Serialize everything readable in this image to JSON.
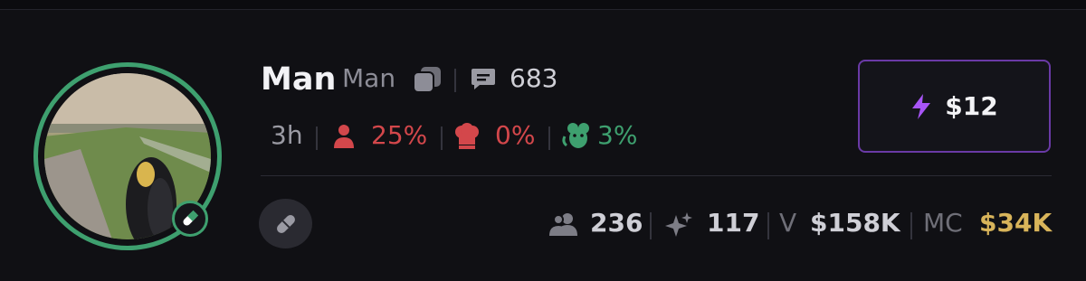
{
  "token": {
    "name": "Man",
    "ticker": "Man",
    "comments": "683",
    "age": "3h",
    "holder_pct": "25%",
    "chef_pct": "0%",
    "rat_pct": "3%"
  },
  "buy": {
    "label": "$12"
  },
  "stats": {
    "holders": "236",
    "boosts": "117",
    "volume_label": "V",
    "volume": "$158K",
    "mc_label": "MC",
    "mc": "$34K"
  },
  "colors": {
    "ring": "#3ea06f",
    "danger": "#d3474b",
    "accent": "#a855f7",
    "mc": "#d8b45a"
  },
  "icons": [
    "copy-icon",
    "comment-icon",
    "holder-icon",
    "chef-icon",
    "rat-icon",
    "lightning-icon",
    "pill-icon",
    "users-icon",
    "sparkle-icon"
  ]
}
